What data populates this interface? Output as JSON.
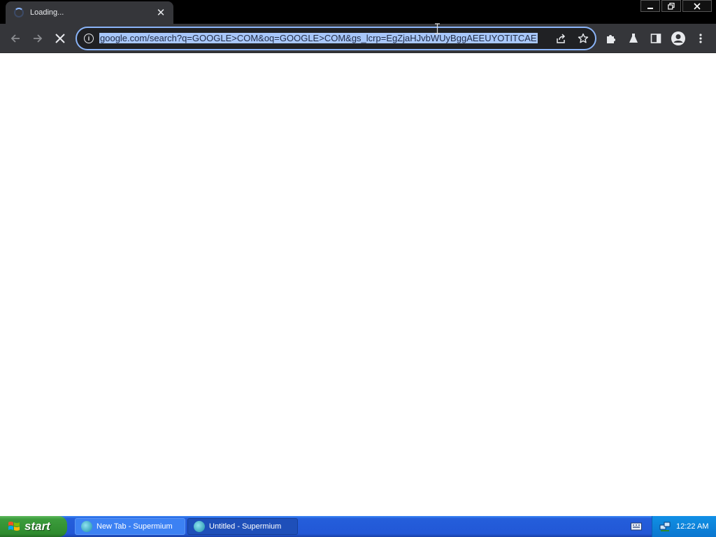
{
  "tab": {
    "title": "Loading...",
    "close_glyph": "✕"
  },
  "window_controls": {
    "minimize": "—",
    "restore": "❐",
    "close": "✕"
  },
  "omnibox": {
    "url": "google.com/search?q=GOOGLE>COM&oq=GOOGLE>COM&gs_lcrp=EgZjaHJvbWUyBggAEEUYOTITCAE",
    "selected": true
  },
  "icons": {
    "back": "back-arrow-icon",
    "forward": "forward-arrow-icon",
    "stop": "stop-icon",
    "site_info": "info-icon",
    "share": "share-icon",
    "bookmark": "star-icon",
    "extensions": "puzzle-icon",
    "labs": "flask-icon",
    "side_panel": "side-panel-icon",
    "profile": "profile-icon",
    "menu": "kebab-menu-icon"
  },
  "colors": {
    "chrome_dark": "#35363a",
    "omnibox_focus": "#8ab4f8",
    "selection": "#a8c7fa",
    "xp_taskbar": "#245edb",
    "xp_start": "#3c9c3c"
  },
  "taskbar": {
    "start_label": "start",
    "items": [
      {
        "label": "New Tab - Supermium",
        "active": false
      },
      {
        "label": "Untitled - Supermium",
        "active": true
      }
    ],
    "clock": "12:22 AM"
  }
}
